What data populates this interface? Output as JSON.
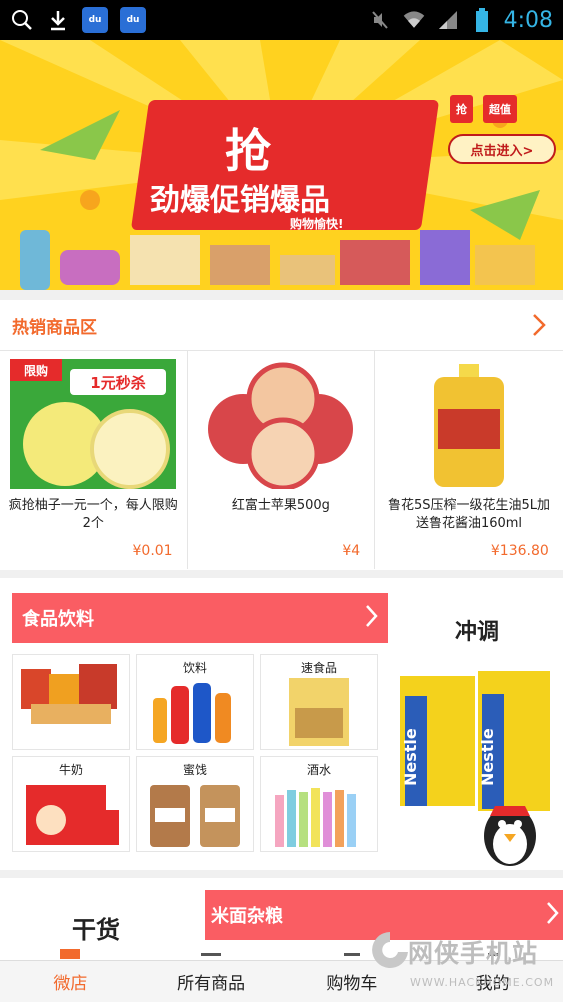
{
  "status_bar": {
    "time": "4:08",
    "left_icons": [
      "search-icon",
      "download-icon",
      "baidu-app-icon",
      "baidu-app-icon"
    ],
    "right_icons": [
      "mute-icon",
      "wifi-icon",
      "signal-icon",
      "battery-icon"
    ],
    "baidu_label": "du"
  },
  "banner": {
    "title_line1": "抢",
    "title_line2": "劲爆促销爆品",
    "subtitle": "购物愉快!",
    "enter_button": "点击进入>",
    "tags": [
      "抢",
      "超值"
    ]
  },
  "hot": {
    "title": "热销商品区",
    "products": [
      {
        "name": "疯抢柚子一元一个，每人限购2个",
        "price": "¥0.01",
        "promo_tag": "1元秒杀",
        "limit_tag": "限购"
      },
      {
        "name": "红富士苹果500g",
        "price": "¥4"
      },
      {
        "name": "鲁花5S压榨一级花生油5L加送鲁花酱油160ml",
        "price": "¥136.80"
      }
    ]
  },
  "categories": {
    "food_banner": "食品饮料",
    "drink_title": "冲调",
    "items": [
      {
        "label": ""
      },
      {
        "label": "饮料"
      },
      {
        "label": "速食品"
      },
      {
        "label": "牛奶"
      },
      {
        "label": "蜜饯"
      },
      {
        "label": "酒水"
      }
    ],
    "brand": "Nestle"
  },
  "dry": {
    "title": "干货",
    "rice_banner": "米面杂粮"
  },
  "tabbar": {
    "tabs": [
      "微店",
      "所有商品",
      "购物车",
      "我的"
    ],
    "active": 0
  },
  "watermark": {
    "text": "网侠手机站",
    "url": "WWW.HACKHOME.COM"
  },
  "colors": {
    "accent": "#f26a2d",
    "banner_red": "#fa5d63",
    "banner_yellow": "#ffd21f",
    "status_time": "#35b5e5"
  }
}
